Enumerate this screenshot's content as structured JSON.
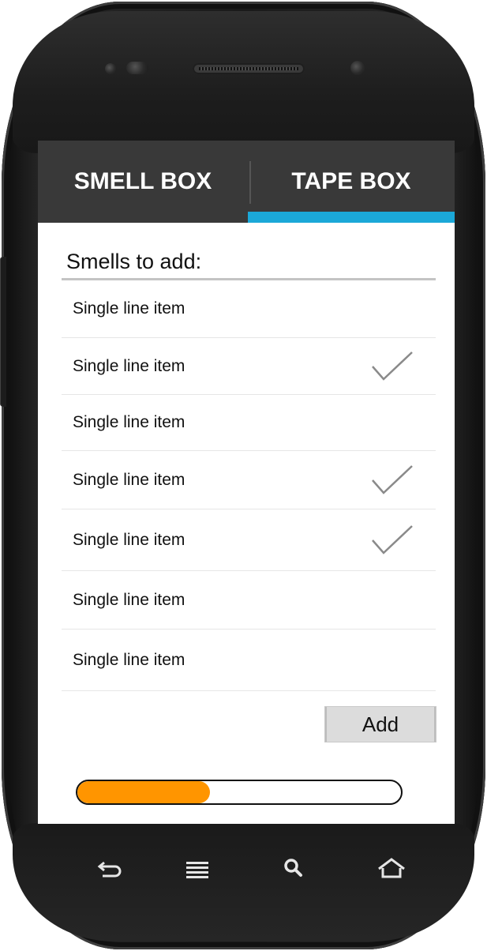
{
  "tabs": [
    {
      "label": "SMELL BOX",
      "selected": false
    },
    {
      "label": "TAPE BOX",
      "selected": true
    }
  ],
  "colors": {
    "tab_bar": "#393939",
    "tab_indicator": "#1ba8d8",
    "progress_fill": "#ff9500",
    "checkmark": "#8a8a8a"
  },
  "section": {
    "title": "Smells to add:"
  },
  "list": {
    "items": [
      {
        "label": "Single line item",
        "checked": false
      },
      {
        "label": "Single line item",
        "checked": true
      },
      {
        "label": "Single line item",
        "checked": false
      },
      {
        "label": "Single line item",
        "checked": true
      },
      {
        "label": "Single line item",
        "checked": true
      },
      {
        "label": "Single line item",
        "checked": false
      },
      {
        "label": "Single line item",
        "checked": false
      }
    ]
  },
  "add_button": {
    "label": "Add"
  },
  "progress": {
    "fraction": 0.41
  },
  "nav_icons": [
    "back-icon",
    "menu-icon",
    "search-icon",
    "home-icon"
  ]
}
